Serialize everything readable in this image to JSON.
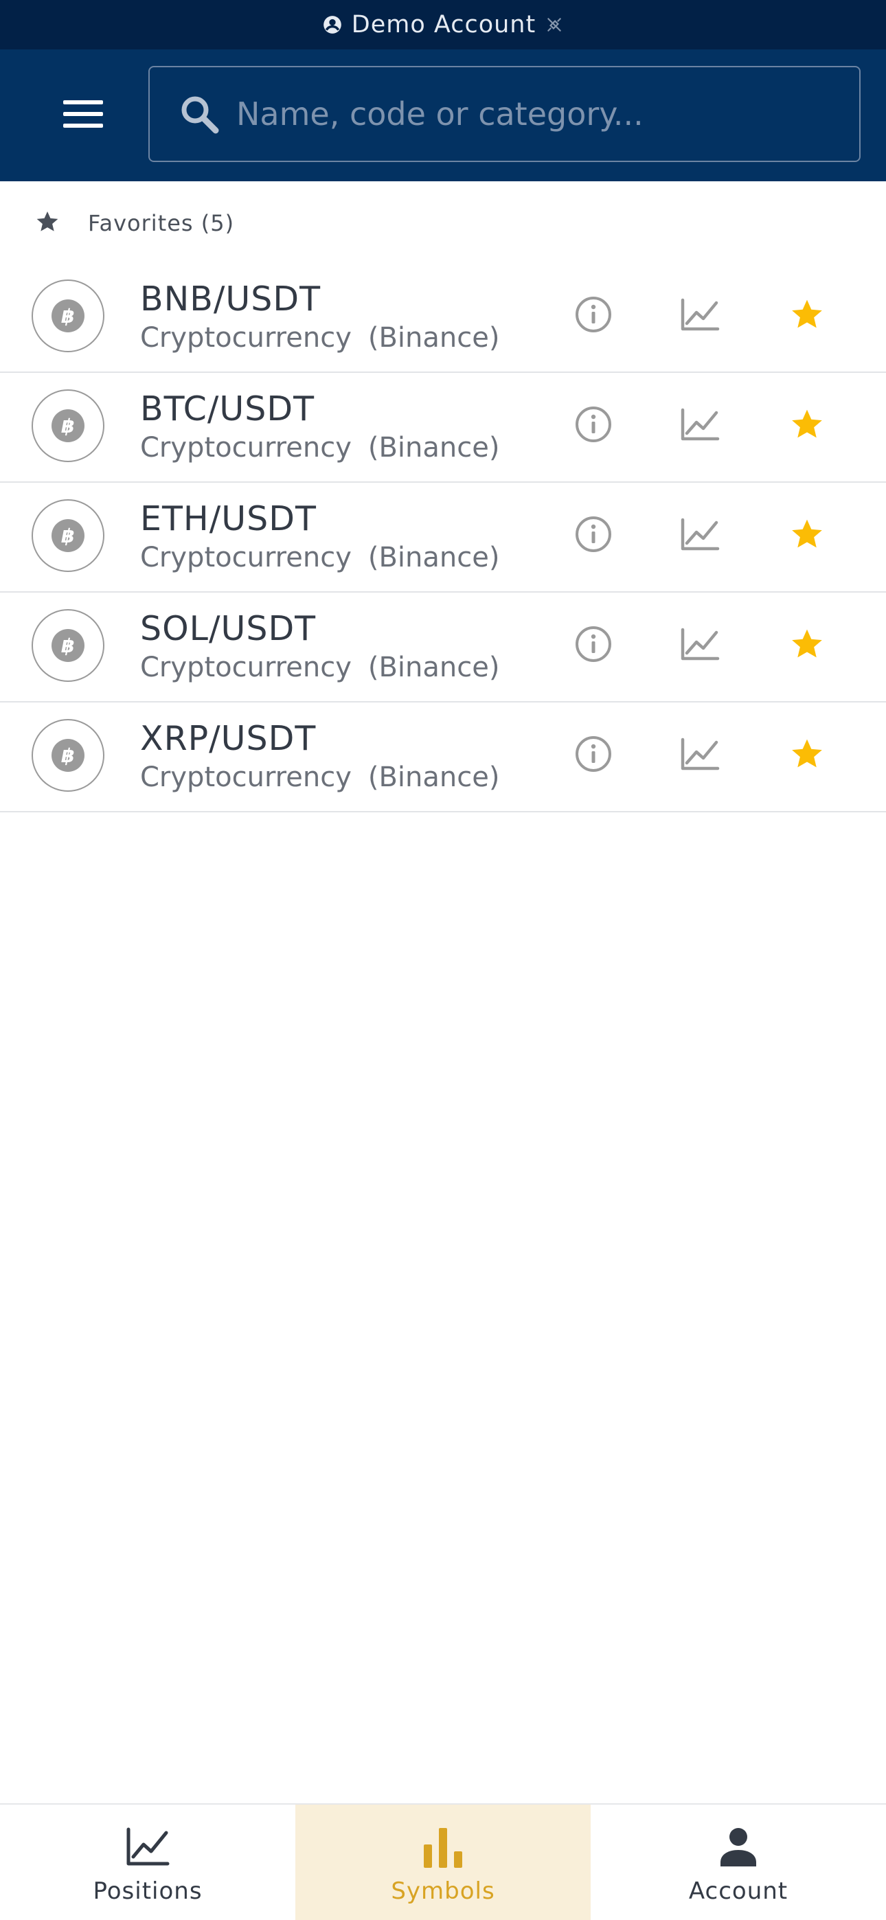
{
  "colors": {
    "status_bar_bg": "#022147",
    "header_bg": "#033262",
    "star_active": "#fbbc05",
    "nav_active_bg": "#f9efd9",
    "nav_active_text": "#d8a323",
    "icon_gray": "#9a9a9a"
  },
  "status_bar": {
    "account_label": "Demo Account",
    "account_icon": "user-circle-icon",
    "connection_icon": "disconnected-plug-icon"
  },
  "header": {
    "menu_icon": "hamburger-menu-icon",
    "search": {
      "placeholder": "Name, code or category...",
      "value": "",
      "icon": "search-icon"
    }
  },
  "favorites": {
    "label": "Favorites (5)",
    "icon": "star-icon"
  },
  "symbols": [
    {
      "name": "BNB/USDT",
      "category": "Cryptocurrency",
      "exchange": "(Binance)",
      "favorite": true
    },
    {
      "name": "BTC/USDT",
      "category": "Cryptocurrency",
      "exchange": "(Binance)",
      "favorite": true
    },
    {
      "name": "ETH/USDT",
      "category": "Cryptocurrency",
      "exchange": "(Binance)",
      "favorite": true
    },
    {
      "name": "SOL/USDT",
      "category": "Cryptocurrency",
      "exchange": "(Binance)",
      "favorite": true
    },
    {
      "name": "XRP/USDT",
      "category": "Cryptocurrency",
      "exchange": "(Binance)",
      "favorite": true
    }
  ],
  "row_icons": {
    "coin": "bitcoin-icon",
    "info": "info-icon",
    "chart": "line-chart-icon",
    "favorite": "star-icon"
  },
  "bottom_nav": {
    "tabs": [
      {
        "label": "Positions",
        "icon": "line-chart-icon",
        "active": false
      },
      {
        "label": "Symbols",
        "icon": "bar-chart-icon",
        "active": true
      },
      {
        "label": "Account",
        "icon": "person-icon",
        "active": false
      }
    ]
  }
}
